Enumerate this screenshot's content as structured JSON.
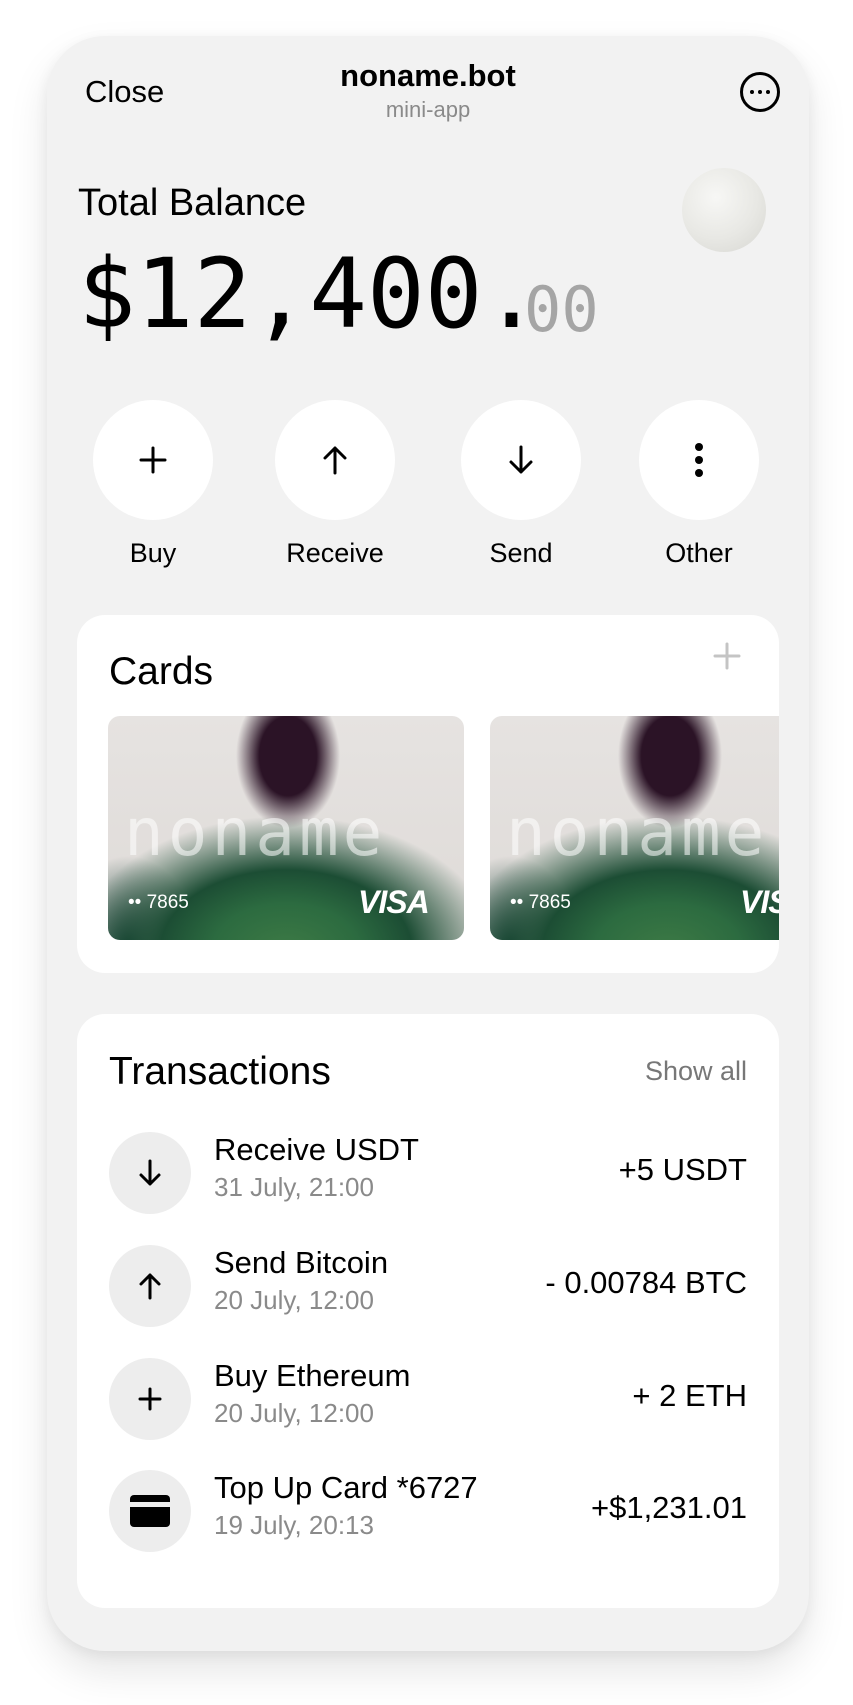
{
  "header": {
    "close_label": "Close",
    "title": "noname.bot",
    "subtitle": "mini-app",
    "menu_icon": "more-horizontal-icon"
  },
  "balance": {
    "label": "Total Balance",
    "amount": "$12,400.",
    "cents": "00"
  },
  "actions": [
    {
      "label": "Buy",
      "icon": "plus-icon"
    },
    {
      "label": "Receive",
      "icon": "arrow-up-icon"
    },
    {
      "label": "Send",
      "icon": "arrow-down-icon"
    },
    {
      "label": "Other",
      "icon": "vertical-dots-icon"
    }
  ],
  "cards": {
    "title": "Cards",
    "items": [
      {
        "wordmark": "noname",
        "digits": "•• 7865",
        "network": "VISA"
      },
      {
        "wordmark": "noname",
        "digits": "•• 7865",
        "network": "VISA"
      }
    ]
  },
  "transactions": {
    "title": "Transactions",
    "show_all": "Show all",
    "items": [
      {
        "title": "Receive USDT",
        "date": "31 July, 21:00",
        "amount": "+5 USDT",
        "icon": "arrow-down-icon"
      },
      {
        "title": "Send Bitcoin",
        "date": "20 July, 12:00",
        "amount": "- 0.00784 BTC",
        "icon": "arrow-up-icon"
      },
      {
        "title": "Buy Ethereum",
        "date": "20 July, 12:00",
        "amount": "+ 2 ETH",
        "icon": "plus-icon"
      },
      {
        "title": "Top Up Card *6727",
        "date": "19 July, 20:13",
        "amount": "+$1,231.01",
        "icon": "card-icon"
      }
    ]
  },
  "colors": {
    "background": "#f2f2f2",
    "panel": "#ffffff",
    "secondary_text": "#8a8a8a",
    "cents": "#a5a5a5"
  }
}
